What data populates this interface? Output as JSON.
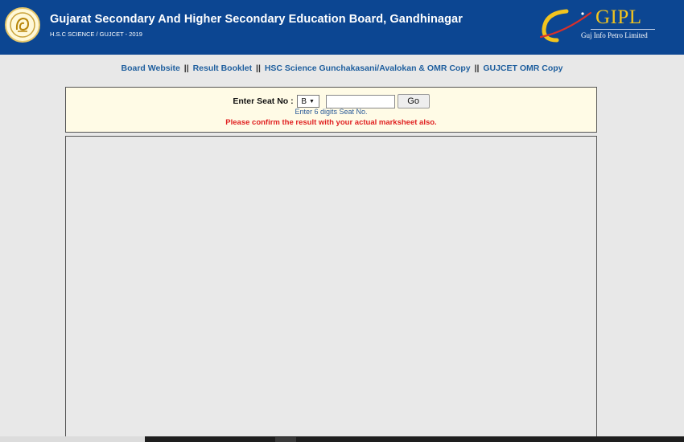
{
  "header": {
    "title": "Gujarat Secondary And Higher Secondary Education Board, Gandhinagar",
    "subtitle": "H.S.C SCIENCE / GUJCET - 2019",
    "partner_mark": "GIPL",
    "partner_name": "Guj Info Petro Limited",
    "colors": {
      "banner": "#0c4692",
      "partner_mark": "#f2c41e"
    }
  },
  "nav": {
    "links": [
      {
        "label": "Board Website"
      },
      {
        "label": "Result Booklet"
      },
      {
        "label": "HSC Science Gunchakasani/Avalokan & OMR Copy"
      },
      {
        "label": "GUJCET OMR Copy"
      }
    ],
    "separator": "||"
  },
  "seat_form": {
    "label": "Enter Seat No :",
    "series_value": "B",
    "seat_value": "",
    "go_label": "Go",
    "hint": "Enter 6 digits Seat No.",
    "warning": "Please confirm the result with your actual marksheet also.",
    "colors": {
      "box_bg": "#fffbe6",
      "hint": "#2a5a98",
      "warning": "#e02020"
    }
  }
}
